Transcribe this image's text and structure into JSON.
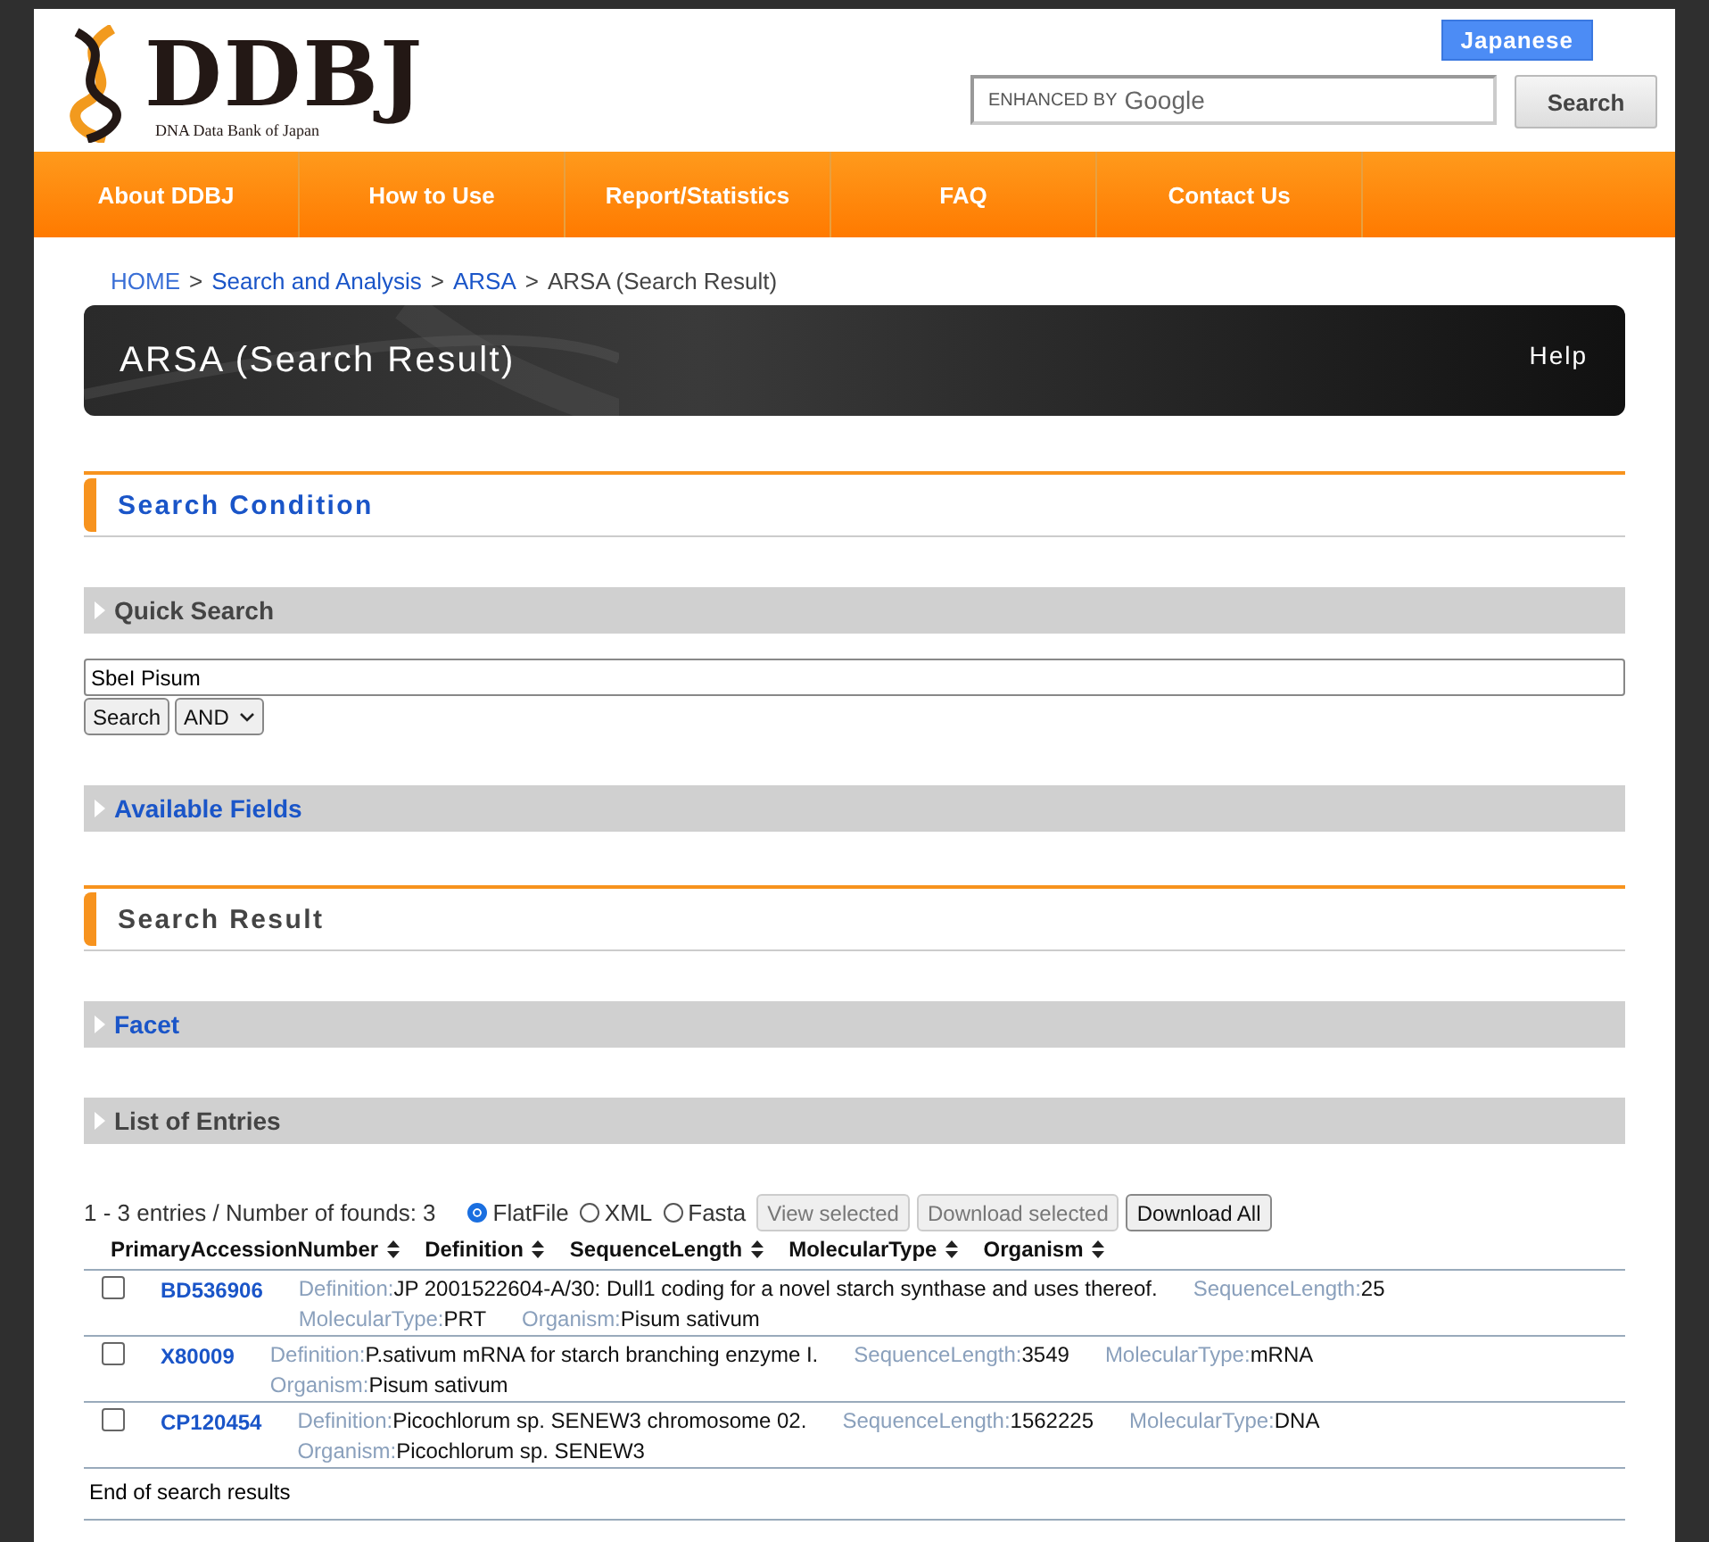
{
  "header": {
    "logo_text": "DDBJ",
    "logo_subtitle": "DNA Data Bank of Japan",
    "language_button": "Japanese",
    "search": {
      "placeholder": "ENHANCED BY Google"
    },
    "search_button": "Search"
  },
  "nav": [
    "About DDBJ",
    "How to Use",
    "Report/Statistics",
    "FAQ",
    "Contact Us"
  ],
  "breadcrumb_separator": ">",
  "breadcrumb": [
    {
      "label": "HOME",
      "link": true
    },
    {
      "label": "Search and Analysis",
      "link": true
    },
    {
      "label": "ARSA",
      "link": true
    },
    {
      "label": "ARSA (Search Result)",
      "link": false
    }
  ],
  "banner": {
    "title": "ARSA (Search Result)",
    "help": "Help"
  },
  "sections": {
    "search_condition": "Search Condition",
    "quick_search": "Quick Search",
    "available_fields": "Available Fields",
    "search_result": "Search Result",
    "facet": "Facet",
    "list_of_entries": "List of Entries"
  },
  "query": {
    "value": "SbeI Pisum",
    "search_button": "Search",
    "operator": "AND"
  },
  "results": {
    "summary": "1 - 3 entries / Number of founds: 3",
    "formats": [
      {
        "label": "FlatFile",
        "selected": true
      },
      {
        "label": "XML",
        "selected": false
      },
      {
        "label": "Fasta",
        "selected": false
      }
    ],
    "buttons": [
      {
        "label": "View selected",
        "disabled": true
      },
      {
        "label": "Download selected",
        "disabled": true
      },
      {
        "label": "Download All",
        "disabled": false
      }
    ],
    "columns": [
      "PrimaryAccessionNumber",
      "Definition",
      "SequenceLength",
      "MolecularType",
      "Organism"
    ],
    "entries": [
      {
        "accession": "BD536906",
        "checked": false,
        "fields": [
          {
            "label": "Definition:",
            "value": "JP 2001522604-A/30: Dull1 coding for a novel starch synthase and uses thereof."
          },
          {
            "label": "SequenceLength:",
            "value": "25"
          },
          {
            "label": "MolecularType:",
            "value": "PRT"
          },
          {
            "label": "Organism:",
            "value": "Pisum sativum"
          }
        ]
      },
      {
        "accession": "X80009",
        "checked": false,
        "fields": [
          {
            "label": "Definition:",
            "value": "P.sativum mRNA for starch branching enzyme I."
          },
          {
            "label": "SequenceLength:",
            "value": "3549"
          },
          {
            "label": "MolecularType:",
            "value": "mRNA"
          },
          {
            "label": "Organism:",
            "value": "Pisum sativum"
          }
        ]
      },
      {
        "accession": "CP120454",
        "checked": false,
        "fields": [
          {
            "label": "Definition:",
            "value": "Picochlorum sp. SENEW3 chromosome 02."
          },
          {
            "label": "SequenceLength:",
            "value": "1562225"
          },
          {
            "label": "MolecularType:",
            "value": "DNA"
          },
          {
            "label": "Organism:",
            "value": "Picochlorum sp. SENEW3"
          }
        ]
      }
    ],
    "footer": "End of search results"
  }
}
